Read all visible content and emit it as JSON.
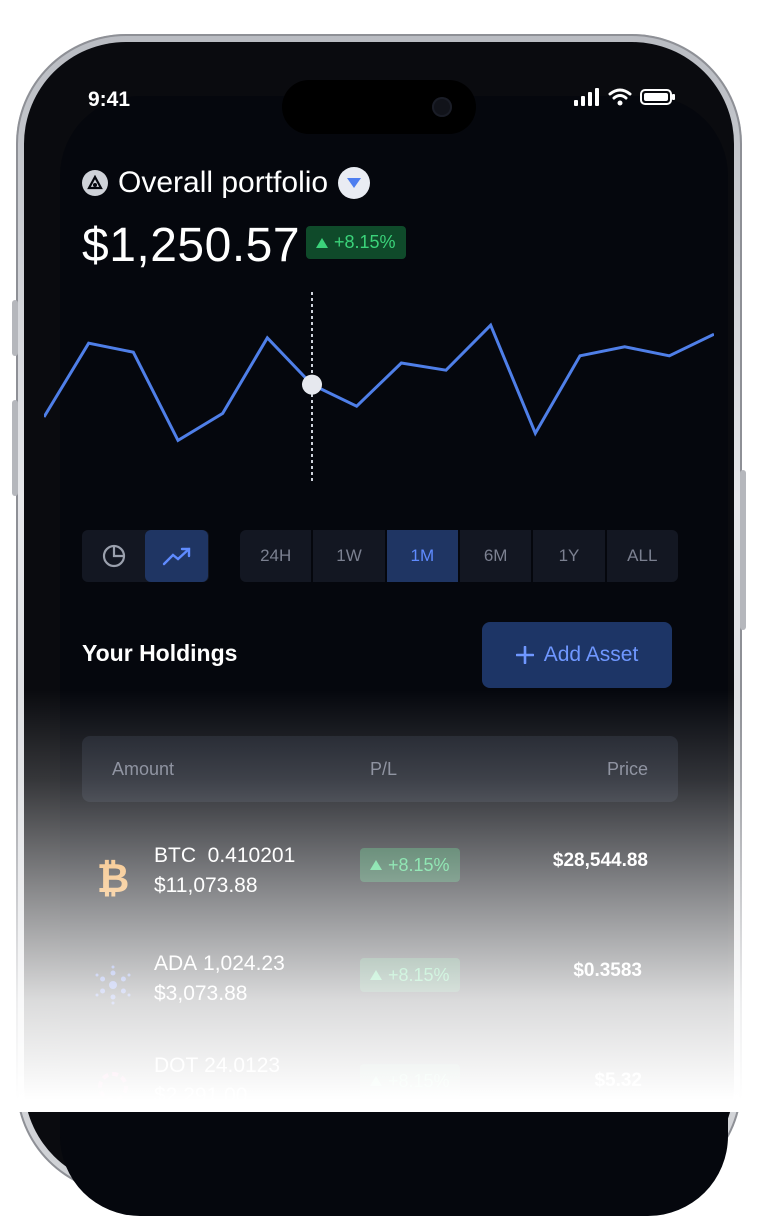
{
  "status": {
    "time": "9:41"
  },
  "header": {
    "title": "Overall portfolio",
    "balance": "$1,250.57",
    "change": "+8.15%"
  },
  "chart_data": {
    "type": "line",
    "series": [
      {
        "values": [
          35,
          76,
          71,
          22,
          37,
          79,
          53,
          41,
          65,
          61,
          86,
          26,
          69,
          74,
          69,
          81
        ]
      }
    ],
    "marker_index": 6,
    "ylim": [
      0,
      100
    ],
    "grid": false,
    "color": "#4f7fe8"
  },
  "view_toggle": {
    "options": [
      "pie-chart-icon",
      "trend-icon"
    ],
    "selected": "trend-icon"
  },
  "ranges": {
    "items": [
      "24H",
      "1W",
      "1M",
      "6M",
      "1Y",
      "ALL"
    ],
    "selected": "1M"
  },
  "holdings": {
    "title": "Your Holdings",
    "add_label": "Add Asset",
    "columns": {
      "amount": "Amount",
      "pl": "P/L",
      "price": "Price"
    },
    "rows": [
      {
        "symbol": "BTC",
        "amount": "0.410201",
        "value": "$11,073.88",
        "pl": "+8.15%",
        "price": "$28,544.88"
      },
      {
        "symbol": "ADA",
        "amount": "1,024.23",
        "value": "$3,073.88",
        "pl": "+8.15%",
        "price": "$0.3583"
      },
      {
        "symbol": "DOT",
        "amount": "24.0123",
        "value": "$2,291.00",
        "pl": "+8.15%",
        "price": "$5.32"
      }
    ]
  },
  "colors": {
    "accent": "#5f8bff",
    "positive": "#3bd37a",
    "background": "#05070d"
  }
}
